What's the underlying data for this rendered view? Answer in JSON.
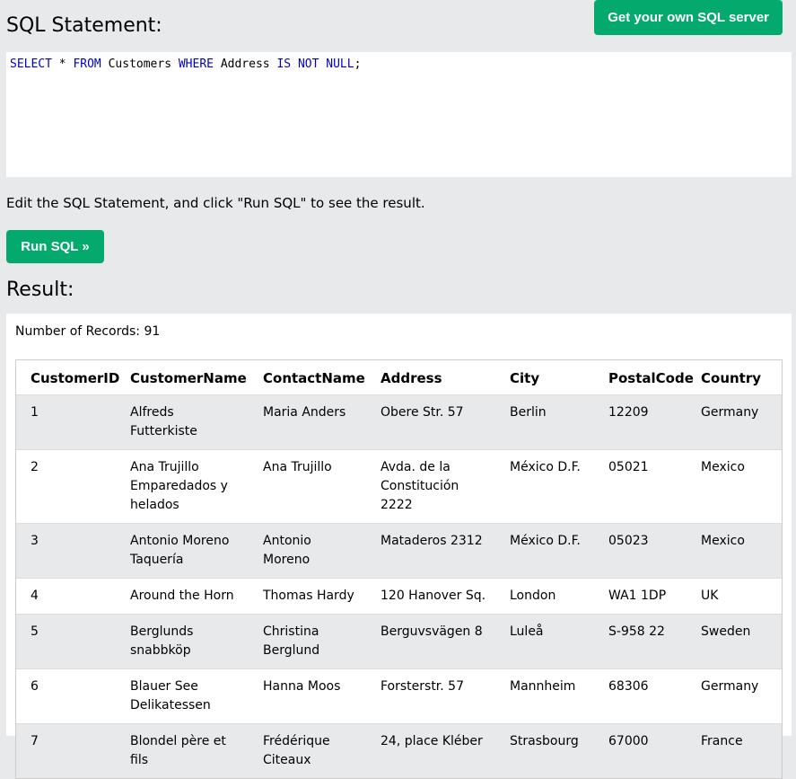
{
  "header": {
    "title": "SQL Statement:",
    "server_button": "Get your own SQL server"
  },
  "editor": {
    "tokens": [
      {
        "text": "SELECT",
        "kw": true
      },
      {
        "text": " * ",
        "kw": false
      },
      {
        "text": "FROM",
        "kw": true
      },
      {
        "text": " Customers ",
        "kw": false
      },
      {
        "text": "WHERE",
        "kw": true
      },
      {
        "text": " Address ",
        "kw": false
      },
      {
        "text": "IS",
        "kw": true
      },
      {
        "text": " ",
        "kw": false
      },
      {
        "text": "NOT",
        "kw": true
      },
      {
        "text": " ",
        "kw": false
      },
      {
        "text": "NULL",
        "kw": true
      },
      {
        "text": ";",
        "kw": false
      }
    ]
  },
  "instructions": "Edit the SQL Statement, and click \"Run SQL\" to see the result.",
  "run_button": "Run SQL »",
  "result": {
    "title": "Result:",
    "records": "Number of Records: 91",
    "columns": [
      "CustomerID",
      "CustomerName",
      "ContactName",
      "Address",
      "City",
      "PostalCode",
      "Country"
    ],
    "rows": [
      [
        "1",
        "Alfreds Futterkiste",
        "Maria Anders",
        "Obere Str. 57",
        "Berlin",
        "12209",
        "Germany"
      ],
      [
        "2",
        "Ana Trujillo Emparedados y helados",
        "Ana Trujillo",
        "Avda. de la Constitución 2222",
        "México D.F.",
        "05021",
        "Mexico"
      ],
      [
        "3",
        "Antonio Moreno Taquería",
        "Antonio Moreno",
        "Mataderos 2312",
        "México D.F.",
        "05023",
        "Mexico"
      ],
      [
        "4",
        "Around the Horn",
        "Thomas Hardy",
        "120 Hanover Sq.",
        "London",
        "WA1 1DP",
        "UK"
      ],
      [
        "5",
        "Berglunds snabbköp",
        "Christina Berglund",
        "Berguvsvägen 8",
        "Luleå",
        "S-958 22",
        "Sweden"
      ],
      [
        "6",
        "Blauer See Delikatessen",
        "Hanna Moos",
        "Forsterstr. 57",
        "Mannheim",
        "68306",
        "Germany"
      ],
      [
        "7",
        "Blondel père et fils",
        "Frédérique Citeaux",
        "24, place Kléber",
        "Strasbourg",
        "67000",
        "France"
      ]
    ]
  }
}
